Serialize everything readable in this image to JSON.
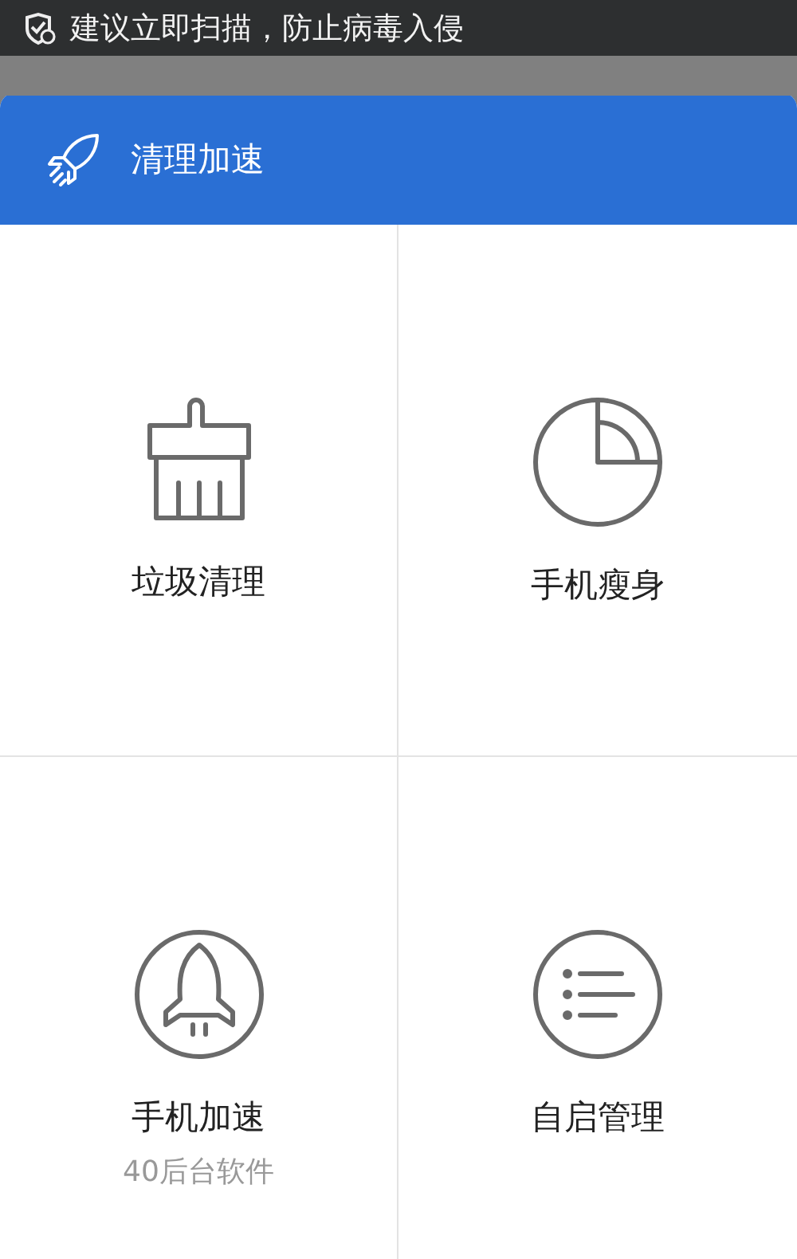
{
  "notification": {
    "text": "建议立即扫描，防止病毒入侵"
  },
  "panel": {
    "title": "清理加速"
  },
  "tiles": [
    {
      "kind": "broom",
      "label": "垃圾清理"
    },
    {
      "kind": "pie",
      "label": "手机瘦身"
    },
    {
      "kind": "rocket",
      "label": "手机加速",
      "subtitle": "40后台软件"
    },
    {
      "kind": "list",
      "label": "自启管理"
    }
  ]
}
